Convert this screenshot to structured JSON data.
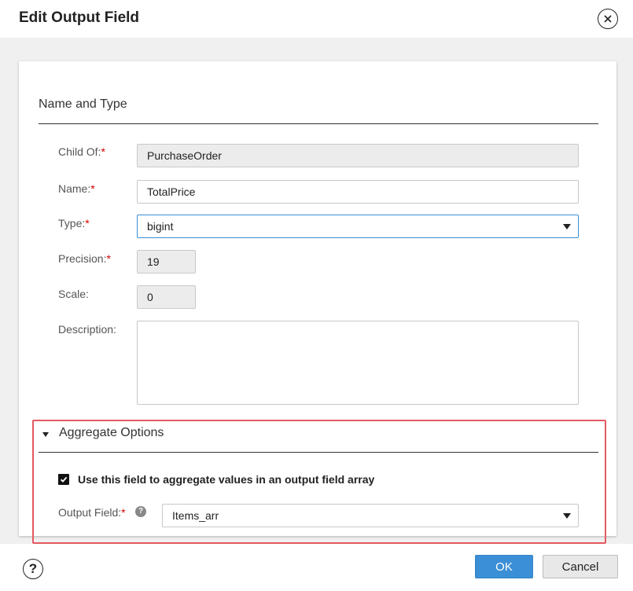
{
  "dialog": {
    "title": "Edit Output Field"
  },
  "section": {
    "title": "Name and Type"
  },
  "fields": {
    "child_of": {
      "label": "Child Of:",
      "value": "PurchaseOrder"
    },
    "name": {
      "label": "Name:",
      "value": "TotalPrice"
    },
    "type": {
      "label": "Type:",
      "value": "bigint"
    },
    "precision": {
      "label": "Precision:",
      "value": "19"
    },
    "scale": {
      "label": "Scale:",
      "value": "0"
    },
    "description": {
      "label": "Description:",
      "value": ""
    },
    "required_mark": "*"
  },
  "aggregate": {
    "title": "Aggregate Options",
    "checkbox_label": "Use this field to aggregate values in an output field array",
    "checked": true,
    "output_field": {
      "label": "Output Field:",
      "value": "Items_arr",
      "help_glyph": "?"
    }
  },
  "footer": {
    "help_glyph": "?",
    "ok_label": "OK",
    "cancel_label": "Cancel"
  },
  "icons": [
    "close-icon",
    "help-icon",
    "caret-down-icon",
    "checkmark-icon"
  ],
  "colors": {
    "primary": "#3b8fd6",
    "required": "#d00000",
    "highlight": "#e45a60",
    "background": "#f0f0f0"
  }
}
